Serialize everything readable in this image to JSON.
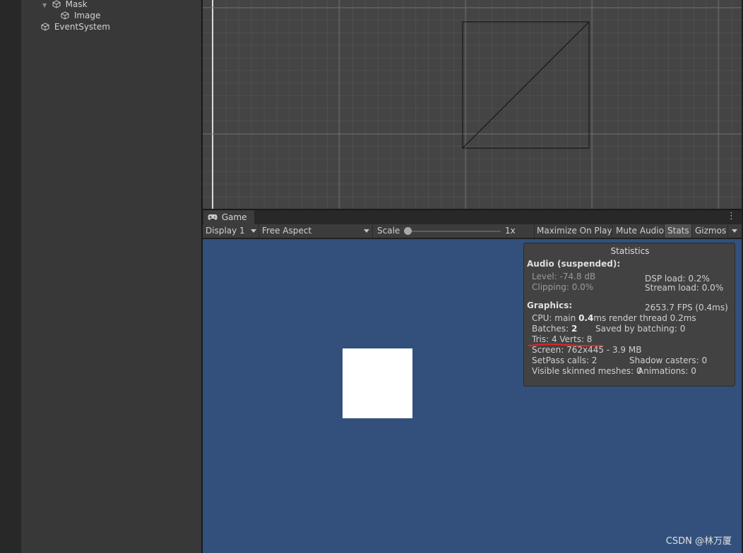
{
  "hierarchy": {
    "items": [
      {
        "label": "Mask",
        "expanded": true
      },
      {
        "label": "Image"
      },
      {
        "label": "EventSystem"
      }
    ]
  },
  "game": {
    "tab_label": "Game",
    "toolbar": {
      "display": "Display 1",
      "aspect": "Free Aspect",
      "scale_label": "Scale",
      "scale_value": "1x",
      "maximize": "Maximize On Play",
      "mute": "Mute Audio",
      "stats": "Stats",
      "gizmos": "Gizmos"
    },
    "watermark": "CSDN @林万厦"
  },
  "stats": {
    "title": "Statistics",
    "audio_header": "Audio (suspended):",
    "level": "Level: -74.8 dB",
    "dsp_load": "DSP load: 0.2%",
    "clipping": "Clipping: 0.0%",
    "stream_load": "Stream load: 0.0%",
    "graphics_header": "Graphics:",
    "fps": "2653.7 FPS (0.4ms)",
    "cpu_prefix": "CPU: main ",
    "cpu_main": "0.4",
    "cpu_suffix": "ms  render thread 0.2ms",
    "batches_prefix": "Batches: ",
    "batches": "2",
    "saved_batching": "Saved by batching: 0",
    "tris_verts": "Tris: 4   Verts: 8",
    "screen": "Screen: 762x445 - 3.9 MB",
    "setpass": "SetPass calls: 2",
    "shadow_casters": "Shadow casters: 0",
    "skinned": "Visible skinned meshes: 0",
    "animations": "Animations: 0"
  },
  "colors": {
    "game_background": "#32507b",
    "annotation_underline": "#e0262a",
    "scene_background": "#444444",
    "panel_background": "#383838"
  }
}
